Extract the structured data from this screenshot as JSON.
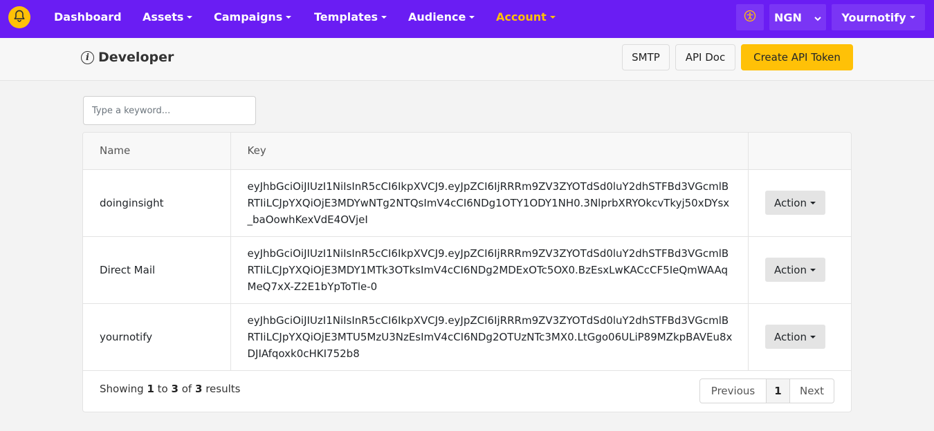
{
  "colors": {
    "brand": "#6a1df3",
    "accent": "#ffc107"
  },
  "nav": {
    "logo_icon": "bell-icon",
    "items": [
      {
        "label": "Dashboard"
      },
      {
        "label": "Assets"
      },
      {
        "label": "Campaigns"
      },
      {
        "label": "Templates"
      },
      {
        "label": "Audience"
      },
      {
        "label": "Account"
      }
    ],
    "accessibility_icon": "accessibility-icon",
    "currency": "NGN",
    "user": "Yournotify"
  },
  "header": {
    "title": "Developer",
    "smtp_label": "SMTP",
    "api_doc_label": "API Doc",
    "create_token_label": "Create API Token"
  },
  "search": {
    "placeholder": "Type a keyword..."
  },
  "table": {
    "columns": [
      "Name",
      "Key",
      ""
    ],
    "rows": [
      {
        "name": "doinginsight",
        "key": "eyJhbGciOiJIUzI1NiIsInR5cCI6IkpXVCJ9.eyJpZCI6IjRRRm9ZV3ZYOTdSd0luY2dhSTFBd3VGcmlBRTIiLCJpYXQiOjE3MDYwNTg2NTQsImV4cCI6NDg1OTY1ODY1NH0.3NlprbXRYOkcvTkyj50xDYsx_baOowhKexVdE4OVjeI",
        "action": "Action"
      },
      {
        "name": "Direct Mail",
        "key": "eyJhbGciOiJIUzI1NiIsInR5cCI6IkpXVCJ9.eyJpZCI6IjRRRm9ZV3ZYOTdSd0luY2dhSTFBd3VGcmlBRTIiLCJpYXQiOjE3MDY1MTk3OTksImV4cCI6NDg2MDExOTc5OX0.BzEsxLwKACcCF5IeQmWAAqMeQ7xX-Z2E1bYpToTle-0",
        "action": "Action"
      },
      {
        "name": "yournotify",
        "key": "eyJhbGciOiJIUzI1NiIsInR5cCI6IkpXVCJ9.eyJpZCI6IjRRRm9ZV3ZYOTdSd0luY2dhSTFBd3VGcmlBRTIiLCJpYXQiOjE3MTU5MzU3NzEsImV4cCI6NDg2OTUzNTc3MX0.LtGgo06ULiP89MZkpBAVEu8xDJIAfqoxk0cHKI752b8",
        "action": "Action"
      }
    ]
  },
  "footer": {
    "showing": "Showing",
    "from": "1",
    "to_word": "to",
    "to": "3",
    "of_word": "of",
    "total": "3",
    "results_word": "results",
    "prev_label": "Previous",
    "page": "1",
    "next_label": "Next"
  }
}
